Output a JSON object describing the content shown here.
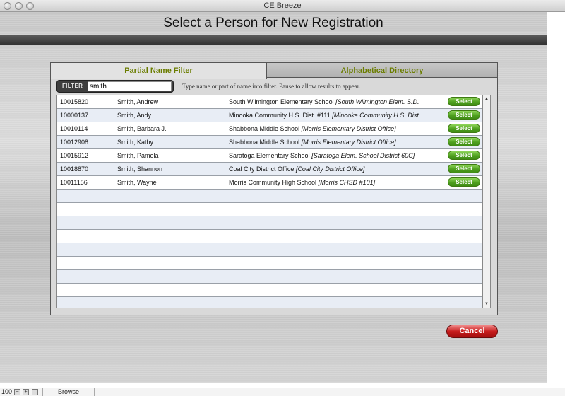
{
  "window": {
    "title": "CE Breeze"
  },
  "header": {
    "title": "Select a Person for New Registration"
  },
  "tabs": [
    {
      "label": "Partial Name Filter",
      "active": true
    },
    {
      "label": "Alphabetical Directory",
      "active": false
    }
  ],
  "filter": {
    "label": "FILTER",
    "value": "smith",
    "hint": "Type name or part of name into filter.  Pause to allow results to appear."
  },
  "rows": [
    {
      "id": "10015820",
      "name": "Smith, Andrew",
      "school": "South Wilmington Elementary School",
      "district": "[South Wilmington Elem. S.D.",
      "button": "Select"
    },
    {
      "id": "10000137",
      "name": "Smith, Andy",
      "school": "Minooka Community H.S. Dist. #111",
      "district": "[Minooka Community H.S. Dist.",
      "button": "Select"
    },
    {
      "id": "10010114",
      "name": "Smith, Barbara J.",
      "school": "Shabbona Middle School",
      "district": "[Morris Elementary District Office]",
      "button": "Select"
    },
    {
      "id": "10012908",
      "name": "Smith, Kathy",
      "school": "Shabbona Middle School",
      "district": "[Morris Elementary District Office]",
      "button": "Select"
    },
    {
      "id": "10015912",
      "name": "Smith, Pamela",
      "school": "Saratoga Elementary School",
      "district": "[Saratoga Elem. School District 60C]",
      "button": "Select"
    },
    {
      "id": "10018870",
      "name": "Smith, Shannon",
      "school": "Coal City District Office",
      "district": "[Coal City District Office]",
      "button": "Select"
    },
    {
      "id": "10011156",
      "name": "Smith, Wayne",
      "school": "Morris Community High School",
      "district": "[Morris CHSD #101]",
      "button": "Select"
    }
  ],
  "cancel_label": "Cancel",
  "statusbar": {
    "zoom": "100",
    "mode": "Browse"
  },
  "colors": {
    "tab_text": "#6b7d00",
    "select_button": "#4fa01f",
    "cancel_button": "#c81d1d"
  }
}
